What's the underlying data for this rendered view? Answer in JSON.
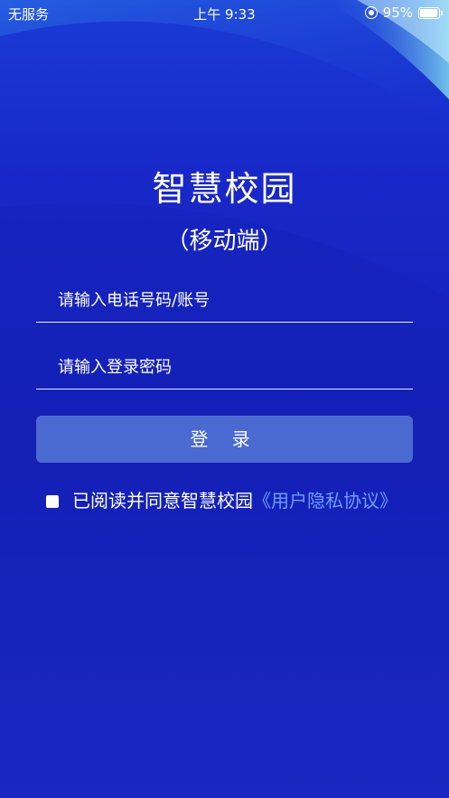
{
  "status_bar": {
    "carrier": "无服务",
    "time": "上午 9:33",
    "battery": "95%",
    "battery_level": 0.95,
    "icons": [
      "orientation-lock-icon",
      "battery-icon"
    ]
  },
  "app": {
    "title": "智慧校园",
    "subtitle": "（移动端）"
  },
  "form": {
    "phone_placeholder": "请输入电话号码/账号",
    "phone_value": "",
    "password_placeholder": "请输入登录密码",
    "password_value": "",
    "login_label": "登 录"
  },
  "agreement": {
    "checked": false,
    "text": "已阅读并同意智慧校园",
    "link_text": "《用户隐私协议》"
  },
  "colors": {
    "background": "#1828c8",
    "button": "#4a6ad1",
    "link": "#6f9bff",
    "text": "#ffffff"
  }
}
